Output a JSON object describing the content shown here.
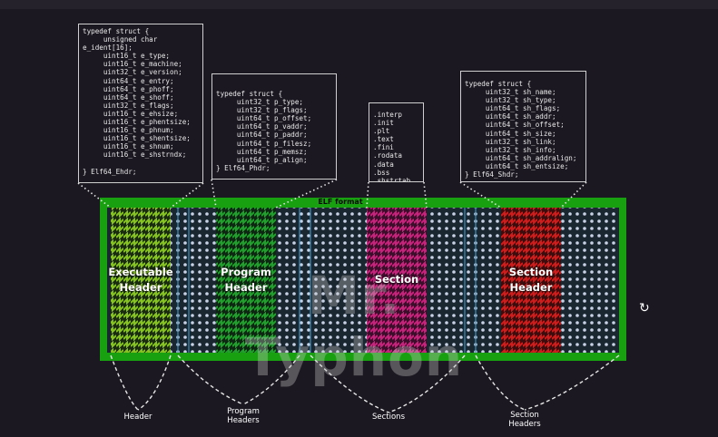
{
  "code_boxes": {
    "ehdr": "typedef struct {\n     unsigned char\ne_ident[16];\n     uint16_t e_type;\n     uint16_t e_machine;\n     uint32_t e_version;\n     uint64_t e_entry;\n     uint64_t e_phoff;\n     uint64_t e_shoff;\n     uint32_t e_flags;\n     uint16_t e_ehsize;\n     uint16_t e_phentsize;\n     uint16_t e_phnum;\n     uint16_t e_shentsize;\n     uint16_t e_shnum;\n     uint16_t e_shstrndx;\n\n} Elf64_Ehdr;",
    "phdr": "typedef struct {\n     uint32_t p_type;\n     uint32_t p_flags;\n     uint64_t p_offset;\n     uint64_t p_vaddr;\n     uint64_t p_paddr;\n     uint64_t p_filesz;\n     uint64_t p_memsz;\n     uint64_t p_align;\n} Elf64_Phdr;",
    "sections": ".interp\n.init\n.plt\n.text\n.fini\n.rodata\n.data\n.bss\n.shstrtab",
    "shdr": "typedef struct {\n     uint32_t sh_name;\n     uint32_t sh_type;\n     uint64_t sh_flags;\n     uint64_t sh_addr;\n     uint64_t sh_offset;\n     uint64_t sh_size;\n     uint32_t sh_link;\n     uint32_t sh_info;\n     uint64_t sh_addralign;\n     uint64_t sh_entsize;\n} Elf64_Shdr;"
  },
  "elf_title": "ELF format",
  "regions": {
    "executable_header": "Executable\nHeader",
    "program_header": "Program\nHeader",
    "section": "Section",
    "section_header": "Section\nHeader"
  },
  "bottom_labels": {
    "header": "Header",
    "program_headers": "Program\nHeaders",
    "sections": "Sections",
    "section_headers": "Section\nHeaders"
  },
  "watermark": "Mr. Typhon",
  "replay_icon": "replay-icon",
  "colors": {
    "background": "#1c1821",
    "frame": "#19a011",
    "dot_fill": "#c8d2e6",
    "dot_bg": "#1b2730",
    "exec_stripe": "#86c51f",
    "prog_stripe": "#1fa12b",
    "section_stripe": "#c8227d",
    "shdr_stripe": "#d21b1b",
    "divider": "#3a8fbf"
  }
}
